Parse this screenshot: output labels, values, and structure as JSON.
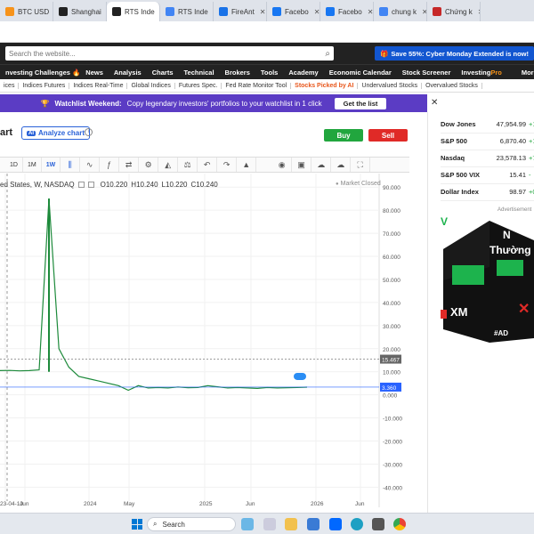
{
  "browser": {
    "tabs": [
      {
        "label": "BTC USD",
        "icon_color": "#f7931a",
        "active": false
      },
      {
        "label": "Shanghai",
        "icon_color": "#222222",
        "active": false
      },
      {
        "label": "RTS Inde",
        "icon_color": "#222222",
        "active": true
      },
      {
        "label": "RTS Inde",
        "icon_color": "#4285f4",
        "active": false
      },
      {
        "label": "FireAnt",
        "icon_color": "#1a73e8",
        "active": false
      },
      {
        "label": "Facebo",
        "icon_color": "#1877f2",
        "active": false
      },
      {
        "label": "Facebo",
        "icon_color": "#1877f2",
        "active": false
      },
      {
        "label": "chung k",
        "icon_color": "#4285f4",
        "active": false
      },
      {
        "label": "Chứng k",
        "icon_color": "#c62828",
        "active": false
      }
    ]
  },
  "header": {
    "search_placeholder": "Search the website...",
    "promo": "Save 55%: Cyber Monday Extended is now!"
  },
  "main_nav": [
    "nvesting Challenges",
    "News",
    "Analysis",
    "Charts",
    "Technical",
    "Brokers",
    "Tools",
    "Academy",
    "Economic Calendar",
    "Stock Screener"
  ],
  "main_nav_pro": {
    "prefix": "Investing",
    "suffix": "Pro"
  },
  "main_nav_more": "More",
  "sub_nav": [
    "ices",
    "Indices Futures",
    "Indices Real-Time",
    "Global Indices",
    "Futures Spec.",
    "Fed Rate Monitor Tool",
    "Stocks Picked by AI",
    "Undervalued Stocks",
    "Overvalued Stocks"
  ],
  "sub_nav_highlight": "Stocks Picked by AI",
  "banner": {
    "title": "Watchlist Weekend:",
    "text": "Copy legendary investors' portfolios to your watchlist in 1 click",
    "button": "Get the list"
  },
  "chart_header": {
    "title": "art",
    "analyze": "Analyze chart",
    "ai_badge": "AI",
    "buy": "Buy",
    "sell": "Sell"
  },
  "toolbar": {
    "intervals": [
      "1D",
      "1M",
      "1W"
    ],
    "active_interval": "1W"
  },
  "legend": {
    "symbol": "ed States, W, NASDAQ",
    "open": "O10.220",
    "high": "H10.240",
    "low": "L10.220",
    "close": "C10.240",
    "status": "Market Closed"
  },
  "sidebar": {
    "indices": [
      {
        "name": "Dow Jones",
        "value": "47,954.99",
        "change": "+10"
      },
      {
        "name": "S&P 500",
        "value": "6,870.40",
        "change": "+1"
      },
      {
        "name": "Nasdaq",
        "value": "23,578.13",
        "change": "+7"
      },
      {
        "name": "S&P 500 VIX",
        "value": "15.41",
        "change": "-"
      },
      {
        "name": "Dollar Index",
        "value": "98.97",
        "change": "+0"
      }
    ],
    "ad_label": "Advertisement",
    "ad": {
      "line1": "N",
      "line2": "Thường",
      "broker": "XM",
      "tag": "#AD"
    }
  },
  "taskbar": {
    "search": "Search"
  },
  "chart_data": {
    "type": "line",
    "series": [
      {
        "x": [
          "2023-04",
          "2023-05",
          "2023-06",
          "2023-07",
          "2023-08",
          "2023-09",
          "2023-10",
          "2023-11",
          "2023-12",
          "2024-01",
          "2024-02",
          "2024-03",
          "2024-04",
          "2024-05",
          "2024-06",
          "2024-07",
          "2024-08",
          "2024-09",
          "2024-10",
          "2024-11",
          "2024-12",
          "2025-01",
          "2025-02",
          "2025-03",
          "2025-04",
          "2025-05",
          "2025-06",
          "2025-07",
          "2025-08",
          "2025-09",
          "2025-10",
          "2025-11"
        ],
        "values": [
          10.5,
          10.6,
          10.4,
          10.5,
          10.8,
          85.0,
          20.0,
          12.0,
          8.0,
          7.0,
          6.0,
          5.0,
          4.0,
          2.0,
          4.0,
          3.0,
          3.2,
          3.0,
          3.4,
          3.1,
          3.2,
          4.0,
          3.5,
          3.0,
          3.2,
          3.0,
          2.8,
          3.2,
          3.0,
          3.1,
          3.2,
          3.36
        ]
      }
    ],
    "x_tick_labels": [
      "23-04-10",
      "Jun",
      "2024",
      "May",
      "2025",
      "Jun",
      "2026",
      "Jun"
    ],
    "y_ticks": [
      "90.000",
      "80.000",
      "70.000",
      "60.000",
      "50.000",
      "40.000",
      "30.000",
      "20.000",
      "10.000",
      "0.000",
      "-10.000",
      "-20.000",
      "-30.000",
      "-40.000"
    ],
    "ylim": [
      -46,
      92
    ],
    "price_tags": [
      "15.467",
      "3.360"
    ],
    "grid": true
  }
}
